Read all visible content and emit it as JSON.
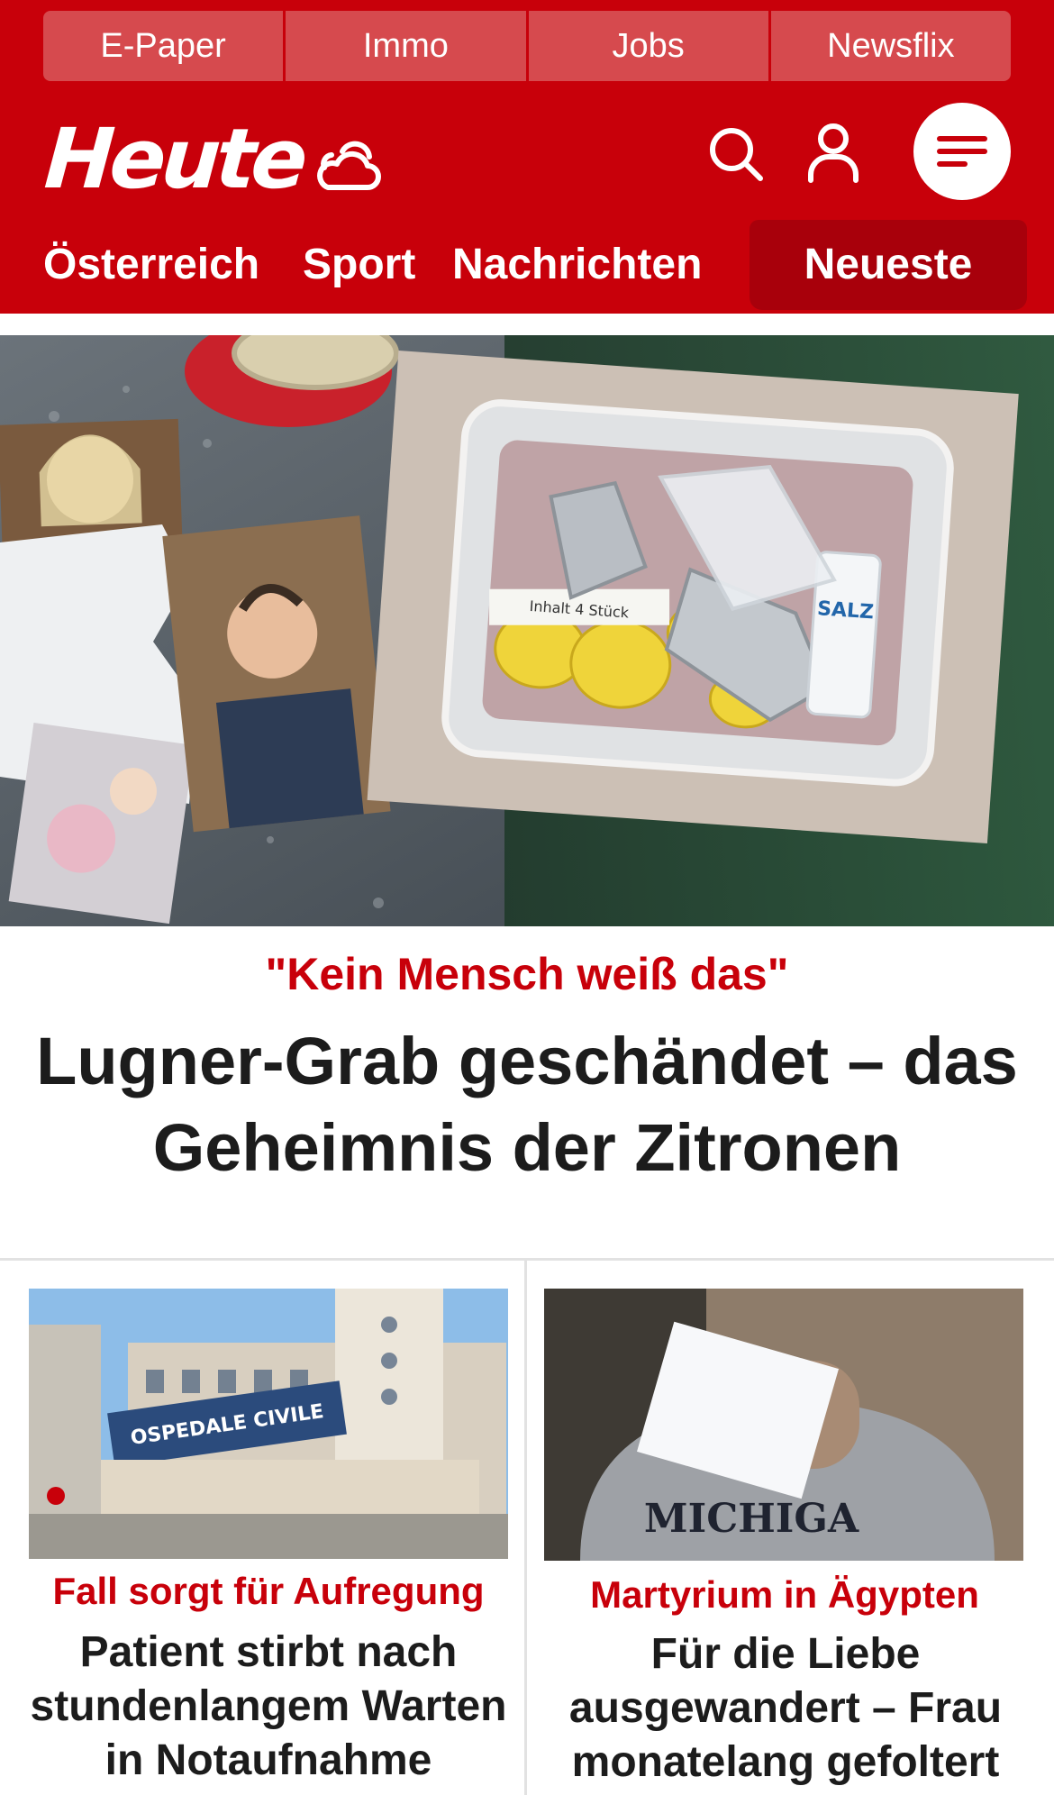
{
  "topnav": {
    "items": [
      "E-Paper",
      "Immo",
      "Jobs",
      "Newsflix"
    ]
  },
  "brand": {
    "logo": "Heute"
  },
  "icons": {
    "weather": "cloud-sun-icon",
    "search": "search-icon",
    "user": "user-icon",
    "menu": "menu-icon"
  },
  "mainnav": {
    "items": [
      "Österreich",
      "Sport",
      "Nachrichten"
    ],
    "active": "Neueste"
  },
  "hero": {
    "kicker": "\"Kein Mensch weiß das\"",
    "headline": "Lugner-Grab geschändet – das Geheimnis der Zitronen",
    "image": {
      "salt_label": "SALZ",
      "net_label": "Inhalt 4 Stück"
    }
  },
  "teasers": [
    {
      "kicker": "Fall sorgt für Aufregung",
      "headline": "Patient stirbt nach stundenlangem Warten in Notaufnahme",
      "image": {
        "sign": "OSPEDALE CIVILE"
      }
    },
    {
      "kicker": "Martyrium in Ägypten",
      "headline": "Für die Liebe ausgewandert – Frau monatelang gefoltert",
      "image": {
        "shirt": "MICHIGA"
      }
    }
  ],
  "colors": {
    "brand_red": "#c8000a",
    "active_tab": "#a8000b",
    "topnav_item": "#d64a4e"
  }
}
